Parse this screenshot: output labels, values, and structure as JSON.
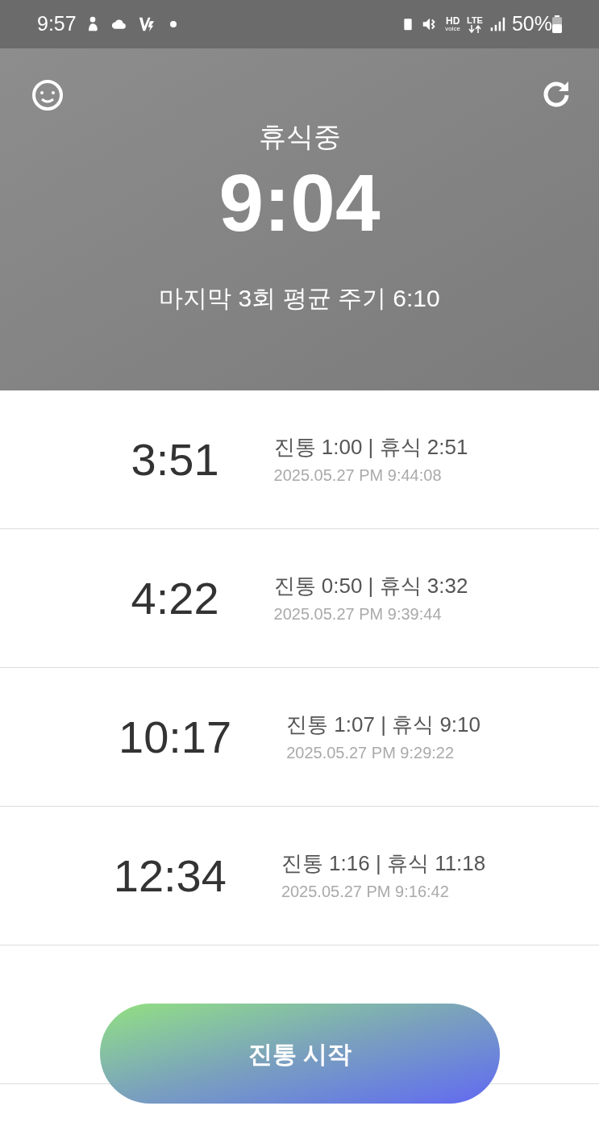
{
  "status_bar": {
    "time": "9:57",
    "hd_label": "HD",
    "voice_label": "voice",
    "lte_label": "LTE",
    "battery": "50%"
  },
  "header": {
    "status": "휴식중",
    "timer": "9:04",
    "average": "마지막 3회 평균 주기 6:10"
  },
  "records": [
    {
      "interval": "3:51",
      "summary": "진통 1:00 | 휴식 2:51",
      "timestamp": "2025.05.27 PM 9:44:08"
    },
    {
      "interval": "4:22",
      "summary": "진통 0:50 | 휴식 3:32",
      "timestamp": "2025.05.27 PM 9:39:44"
    },
    {
      "interval": "10:17",
      "summary": "진통 1:07 | 휴식 9:10",
      "timestamp": "2025.05.27 PM 9:29:22"
    },
    {
      "interval": "12:34",
      "summary": "진통 1:16 | 휴식 11:18",
      "timestamp": "2025.05.27 PM 9:16:42"
    }
  ],
  "start_button": "진통 시작"
}
